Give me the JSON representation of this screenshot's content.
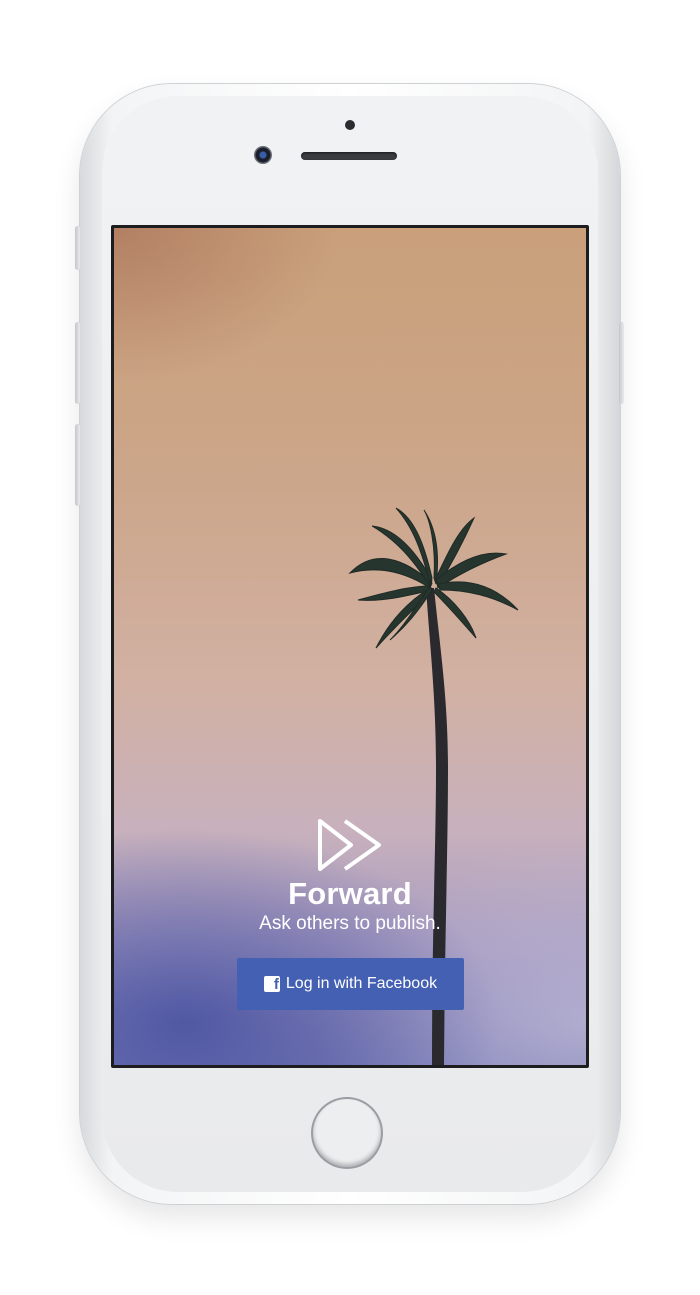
{
  "app": {
    "name": "Forward",
    "tagline": "Ask others to publish."
  },
  "login": {
    "label": "Log in with Facebook",
    "icon": "facebook-icon",
    "color": "#4460b2"
  },
  "background": {
    "subject": "palm-tree"
  },
  "icons": {
    "logo": "fast-forward-icon"
  }
}
